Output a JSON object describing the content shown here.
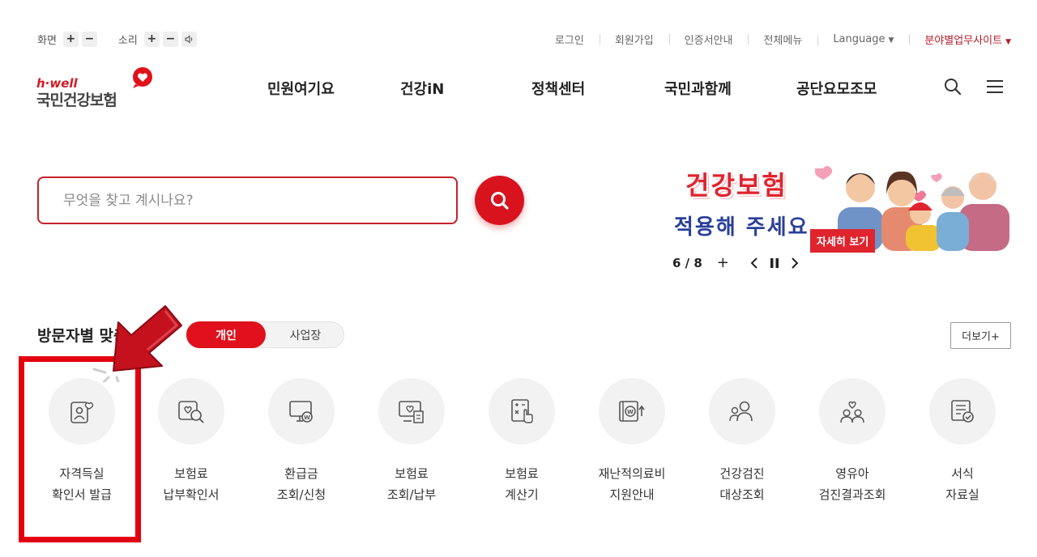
{
  "utility": {
    "screen_label": "화면",
    "sound_label": "소리",
    "plus": "+",
    "minus": "−",
    "links": [
      "로그인",
      "회원가입",
      "인증서안내",
      "전체메뉴"
    ],
    "language": "Language",
    "field_sites": "분야별업무사이트"
  },
  "logo": {
    "tagline": "h·well",
    "name": "국민건강보험"
  },
  "nav": [
    "민원여기요",
    "건강iN",
    "정책센터",
    "국민과함께",
    "공단요모조모"
  ],
  "search": {
    "placeholder": "무엇을 찾고 계시나요?"
  },
  "banner": {
    "line1": "건강보험",
    "line2": "적용해 주세요",
    "button": "자세히 보기",
    "counter": "6 / 8",
    "plus": "+"
  },
  "section": {
    "title": "방문자별 맞춤",
    "tab_personal": "개인",
    "tab_business": "사업장",
    "more": "더보기+"
  },
  "quick_items": [
    {
      "icon": "id-card-heart-icon",
      "line1": "자격득실",
      "line2": "확인서 발급"
    },
    {
      "icon": "search-heart-icon",
      "line1": "보험료",
      "line2": "납부확인서"
    },
    {
      "icon": "refund-monitor-icon",
      "line1": "환급금",
      "line2": "조회/신청"
    },
    {
      "icon": "premium-pay-icon",
      "line1": "보험료",
      "line2": "조회/납부"
    },
    {
      "icon": "calculator-icon",
      "line1": "보험료",
      "line2": "계산기"
    },
    {
      "icon": "disaster-medical-icon",
      "line1": "재난적의료비",
      "line2": "지원안내"
    },
    {
      "icon": "health-checkup-icon",
      "line1": "건강검진",
      "line2": "대상조회"
    },
    {
      "icon": "infant-checkup-icon",
      "line1": "영유아",
      "line2": "검진결과조회"
    },
    {
      "icon": "forms-library-icon",
      "line1": "서식",
      "line2": "자료실"
    }
  ],
  "colors": {
    "brand_red": "#d8131e",
    "highlight_red": "#e3000f",
    "icon_gray": "#555555"
  }
}
